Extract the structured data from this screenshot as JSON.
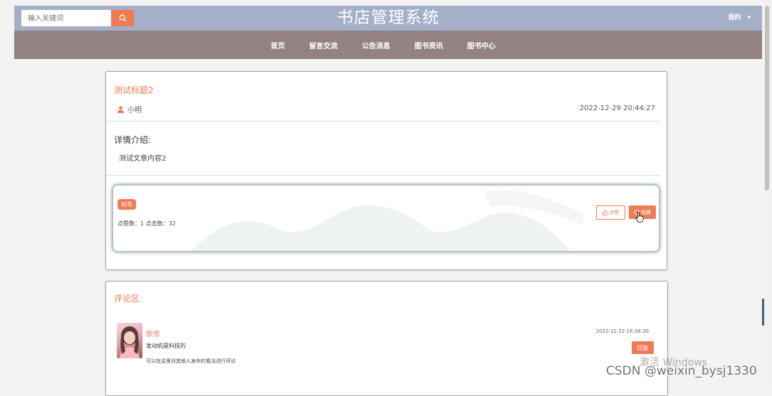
{
  "header": {
    "search": {
      "placeholder": "输入关键词",
      "value": ""
    },
    "title": "书店管理系统",
    "user_menu": "我的",
    "user_menu_caret": "▾"
  },
  "nav": {
    "items": [
      {
        "label": "首页"
      },
      {
        "label": "留言交流"
      },
      {
        "label": "公告消息"
      },
      {
        "label": "图书资讯"
      },
      {
        "label": "图书中心"
      }
    ]
  },
  "article": {
    "title": "测试标题2",
    "author": "小明",
    "date": "2022-12-29 20:44:27",
    "detail_heading": "详情介绍:",
    "content": "测试文章内容2"
  },
  "interaction": {
    "tag": "标签",
    "counts": "点赞数：1   点击数：32",
    "like_label": "点赞",
    "favorite_label": "收藏"
  },
  "comments": {
    "title": "评论区",
    "items": [
      {
        "name": "依依",
        "text": "发动机是科技的",
        "date": "2022-11-22 16:38:30",
        "reply_label": "回复"
      }
    ],
    "hint": "可以在这里对其他人发布的看法进行评论"
  },
  "overlays": {
    "windows": "激活 Windows",
    "csdn": "CSDN @weixin_bysj1330"
  },
  "colors": {
    "accent": "#ef7a54",
    "header_bg": "#a3b0c8",
    "nav_bg": "#938281"
  },
  "icons": [
    "search-icon",
    "user-icon",
    "thumbs-up-icon",
    "heart-icon",
    "hand-cursor-icon",
    "chevron-down-icon"
  ]
}
